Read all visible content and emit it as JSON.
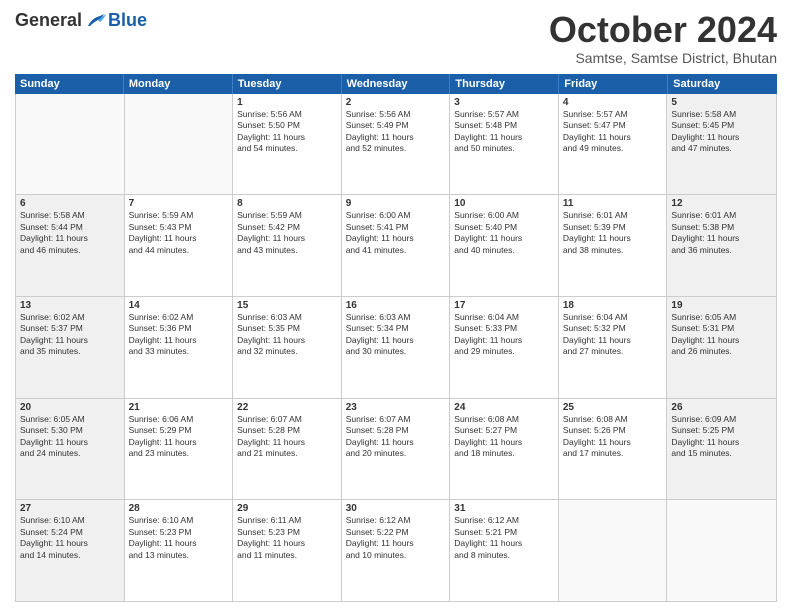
{
  "logo": {
    "general": "General",
    "blue": "Blue"
  },
  "title": "October 2024",
  "subtitle": "Samtse, Samtse District, Bhutan",
  "header_days": [
    "Sunday",
    "Monday",
    "Tuesday",
    "Wednesday",
    "Thursday",
    "Friday",
    "Saturday"
  ],
  "weeks": [
    [
      {
        "day": "",
        "info": "",
        "empty": true
      },
      {
        "day": "",
        "info": "",
        "empty": true
      },
      {
        "day": "1",
        "info": "Sunrise: 5:56 AM\nSunset: 5:50 PM\nDaylight: 11 hours\nand 54 minutes."
      },
      {
        "day": "2",
        "info": "Sunrise: 5:56 AM\nSunset: 5:49 PM\nDaylight: 11 hours\nand 52 minutes."
      },
      {
        "day": "3",
        "info": "Sunrise: 5:57 AM\nSunset: 5:48 PM\nDaylight: 11 hours\nand 50 minutes."
      },
      {
        "day": "4",
        "info": "Sunrise: 5:57 AM\nSunset: 5:47 PM\nDaylight: 11 hours\nand 49 minutes."
      },
      {
        "day": "5",
        "info": "Sunrise: 5:58 AM\nSunset: 5:45 PM\nDaylight: 11 hours\nand 47 minutes.",
        "shaded": true
      }
    ],
    [
      {
        "day": "6",
        "info": "Sunrise: 5:58 AM\nSunset: 5:44 PM\nDaylight: 11 hours\nand 46 minutes.",
        "shaded": true
      },
      {
        "day": "7",
        "info": "Sunrise: 5:59 AM\nSunset: 5:43 PM\nDaylight: 11 hours\nand 44 minutes."
      },
      {
        "day": "8",
        "info": "Sunrise: 5:59 AM\nSunset: 5:42 PM\nDaylight: 11 hours\nand 43 minutes."
      },
      {
        "day": "9",
        "info": "Sunrise: 6:00 AM\nSunset: 5:41 PM\nDaylight: 11 hours\nand 41 minutes."
      },
      {
        "day": "10",
        "info": "Sunrise: 6:00 AM\nSunset: 5:40 PM\nDaylight: 11 hours\nand 40 minutes."
      },
      {
        "day": "11",
        "info": "Sunrise: 6:01 AM\nSunset: 5:39 PM\nDaylight: 11 hours\nand 38 minutes."
      },
      {
        "day": "12",
        "info": "Sunrise: 6:01 AM\nSunset: 5:38 PM\nDaylight: 11 hours\nand 36 minutes.",
        "shaded": true
      }
    ],
    [
      {
        "day": "13",
        "info": "Sunrise: 6:02 AM\nSunset: 5:37 PM\nDaylight: 11 hours\nand 35 minutes.",
        "shaded": true
      },
      {
        "day": "14",
        "info": "Sunrise: 6:02 AM\nSunset: 5:36 PM\nDaylight: 11 hours\nand 33 minutes."
      },
      {
        "day": "15",
        "info": "Sunrise: 6:03 AM\nSunset: 5:35 PM\nDaylight: 11 hours\nand 32 minutes."
      },
      {
        "day": "16",
        "info": "Sunrise: 6:03 AM\nSunset: 5:34 PM\nDaylight: 11 hours\nand 30 minutes."
      },
      {
        "day": "17",
        "info": "Sunrise: 6:04 AM\nSunset: 5:33 PM\nDaylight: 11 hours\nand 29 minutes."
      },
      {
        "day": "18",
        "info": "Sunrise: 6:04 AM\nSunset: 5:32 PM\nDaylight: 11 hours\nand 27 minutes."
      },
      {
        "day": "19",
        "info": "Sunrise: 6:05 AM\nSunset: 5:31 PM\nDaylight: 11 hours\nand 26 minutes.",
        "shaded": true
      }
    ],
    [
      {
        "day": "20",
        "info": "Sunrise: 6:05 AM\nSunset: 5:30 PM\nDaylight: 11 hours\nand 24 minutes.",
        "shaded": true
      },
      {
        "day": "21",
        "info": "Sunrise: 6:06 AM\nSunset: 5:29 PM\nDaylight: 11 hours\nand 23 minutes."
      },
      {
        "day": "22",
        "info": "Sunrise: 6:07 AM\nSunset: 5:28 PM\nDaylight: 11 hours\nand 21 minutes."
      },
      {
        "day": "23",
        "info": "Sunrise: 6:07 AM\nSunset: 5:28 PM\nDaylight: 11 hours\nand 20 minutes."
      },
      {
        "day": "24",
        "info": "Sunrise: 6:08 AM\nSunset: 5:27 PM\nDaylight: 11 hours\nand 18 minutes."
      },
      {
        "day": "25",
        "info": "Sunrise: 6:08 AM\nSunset: 5:26 PM\nDaylight: 11 hours\nand 17 minutes."
      },
      {
        "day": "26",
        "info": "Sunrise: 6:09 AM\nSunset: 5:25 PM\nDaylight: 11 hours\nand 15 minutes.",
        "shaded": true
      }
    ],
    [
      {
        "day": "27",
        "info": "Sunrise: 6:10 AM\nSunset: 5:24 PM\nDaylight: 11 hours\nand 14 minutes.",
        "shaded": true
      },
      {
        "day": "28",
        "info": "Sunrise: 6:10 AM\nSunset: 5:23 PM\nDaylight: 11 hours\nand 13 minutes."
      },
      {
        "day": "29",
        "info": "Sunrise: 6:11 AM\nSunset: 5:23 PM\nDaylight: 11 hours\nand 11 minutes."
      },
      {
        "day": "30",
        "info": "Sunrise: 6:12 AM\nSunset: 5:22 PM\nDaylight: 11 hours\nand 10 minutes."
      },
      {
        "day": "31",
        "info": "Sunrise: 6:12 AM\nSunset: 5:21 PM\nDaylight: 11 hours\nand 8 minutes."
      },
      {
        "day": "",
        "info": "",
        "empty": true
      },
      {
        "day": "",
        "info": "",
        "empty": true,
        "shaded": true
      }
    ]
  ]
}
